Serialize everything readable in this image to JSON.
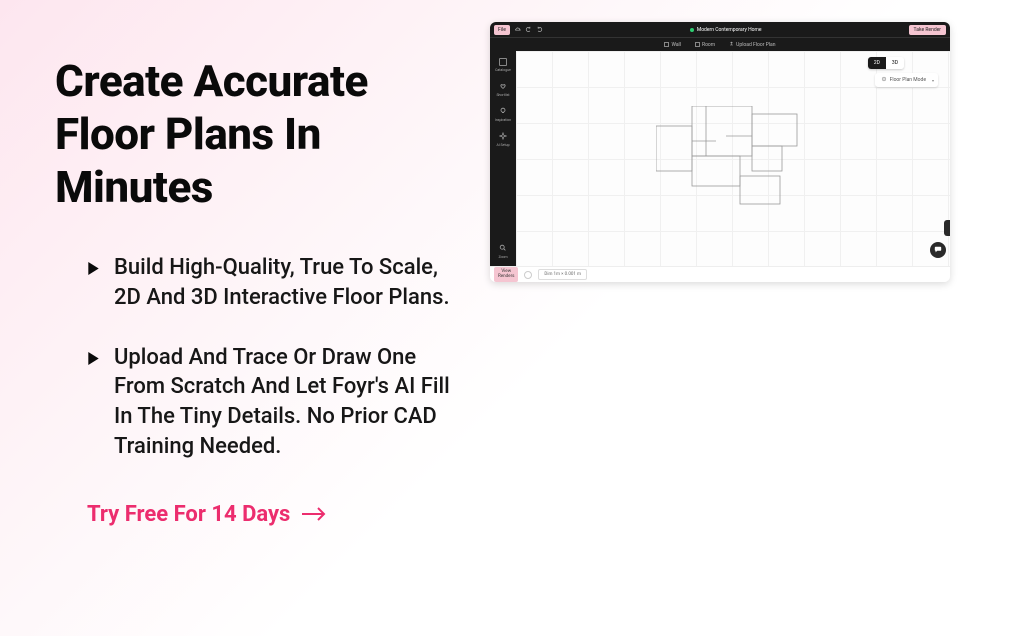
{
  "hero": {
    "headline": "Create Accurate Floor Plans In Minutes",
    "bullets": [
      "Build High-Quality, True To Scale, 2D And 3D Interactive Floor Plans.",
      "Upload And Trace Or Draw One From Scratch And Let Foyr's AI Fill In The Tiny Details. No Prior CAD Training Needed."
    ],
    "cta_label": "Try Free For 14 Days"
  },
  "app": {
    "file_label": "File",
    "project_name": "Modern Contemporary Home",
    "take_render_label": "Take Render",
    "toolbar": {
      "wall": "Wall",
      "room": "Room",
      "upload": "Upload Floor Plan"
    },
    "sidebar": {
      "catalogue": "Catalogue",
      "shortlist": "Shortlist",
      "inspiration": "Inspiration",
      "ai_setup": "AI Setup",
      "zoom": "Zoom"
    },
    "view": {
      "two_d": "2D",
      "three_d": "3D"
    },
    "mode_label": "Floor Plan Mode",
    "bottom": {
      "view_renders": "View\nRenders",
      "dimensions": "Dim 1m × 0.001 m"
    }
  }
}
